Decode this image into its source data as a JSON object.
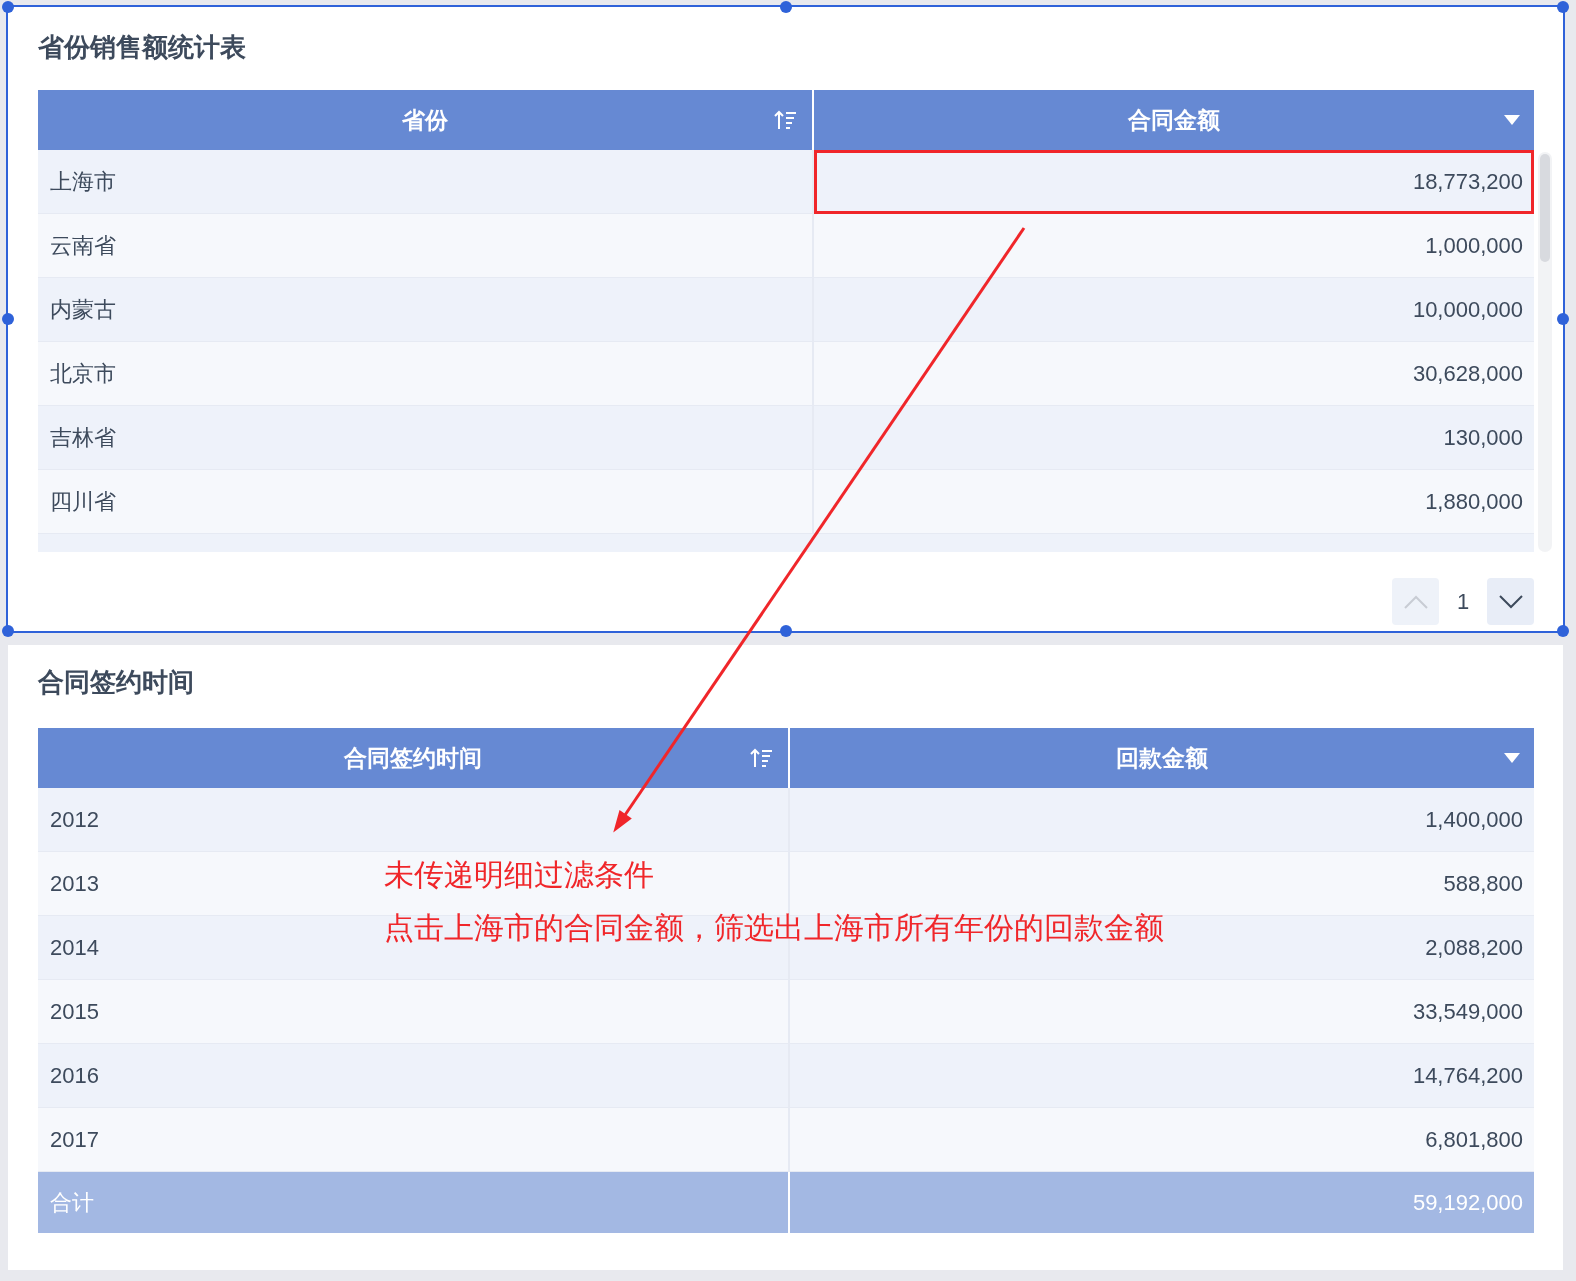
{
  "widgets": [
    {
      "title": "省份销售额统计表",
      "selected": true,
      "columns": [
        {
          "label": "省份",
          "kind": "sortable"
        },
        {
          "label": "合同金额",
          "kind": "menu"
        }
      ],
      "rows": [
        {
          "cells": [
            "上海市",
            "18,773,200"
          ],
          "highlighted": true
        },
        {
          "cells": [
            "云南省",
            "1,000,000"
          ],
          "highlighted": false
        },
        {
          "cells": [
            "内蒙古",
            "10,000,000"
          ],
          "highlighted": false
        },
        {
          "cells": [
            "北京市",
            "30,628,000"
          ],
          "highlighted": false
        },
        {
          "cells": [
            "吉林省",
            "130,000"
          ],
          "highlighted": false
        },
        {
          "cells": [
            "四川省",
            "1,880,000"
          ],
          "highlighted": false
        }
      ],
      "pagination": {
        "page": "1",
        "prev_disabled": true,
        "next_disabled": false
      }
    },
    {
      "title": "合同签约时间",
      "selected": false,
      "columns": [
        {
          "label": "合同签约时间",
          "kind": "sortable"
        },
        {
          "label": "回款金额",
          "kind": "menu"
        }
      ],
      "rows": [
        {
          "cells": [
            "2012",
            "1,400,000"
          ],
          "highlighted": false
        },
        {
          "cells": [
            "2013",
            "588,800"
          ],
          "highlighted": false
        },
        {
          "cells": [
            "2014",
            "2,088,200"
          ],
          "highlighted": false
        },
        {
          "cells": [
            "2015",
            "33,549,000"
          ],
          "highlighted": false
        },
        {
          "cells": [
            "2016",
            "14,764,200"
          ],
          "highlighted": false
        },
        {
          "cells": [
            "2017",
            "6,801,800"
          ],
          "highlighted": false
        }
      ],
      "total": [
        "合计",
        "59,192,000"
      ]
    }
  ],
  "annotation": [
    "未传递明细过滤条件",
    "点击上海市的合同金额，筛选出上海市所有年份的回款金额"
  ]
}
